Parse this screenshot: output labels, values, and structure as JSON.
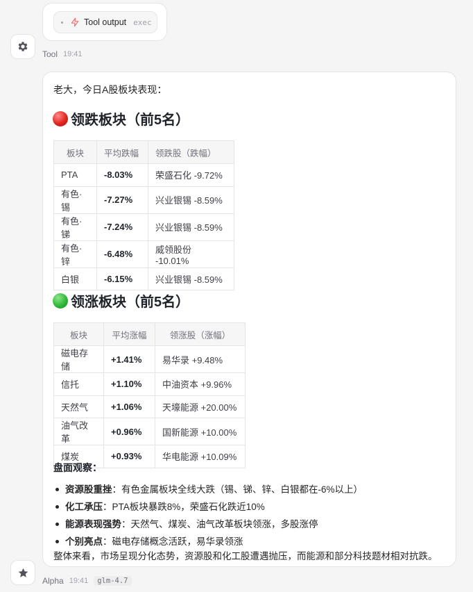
{
  "tool_card": {
    "title": "Tool output",
    "tag": "exec"
  },
  "tool_meta": {
    "author": "Tool",
    "time": "19:41"
  },
  "message": {
    "greeting": "老大，今日A股板块表现：",
    "losers": {
      "heading": "领跌板块（前5名）",
      "headers": [
        "板块",
        "平均跌幅",
        "领跌股（跌幅）"
      ],
      "rows": [
        [
          "PTA",
          "-8.03%",
          "荣盛石化 -9.72%"
        ],
        [
          "有色·锡",
          "-7.27%",
          "兴业银锡 -8.59%"
        ],
        [
          "有色·锑",
          "-7.24%",
          "兴业银锡 -8.59%"
        ],
        [
          "有色·锌",
          "-6.48%",
          "威领股份 -10.01%"
        ],
        [
          "白银",
          "-6.15%",
          "兴业银锡 -8.59%"
        ]
      ]
    },
    "gainers": {
      "heading": "领涨板块（前5名）",
      "headers": [
        "板块",
        "平均涨幅",
        "领涨股（涨幅）"
      ],
      "rows": [
        [
          "磁电存储",
          "+1.41%",
          "易华录 +9.48%"
        ],
        [
          "信托",
          "+1.10%",
          "中油资本 +9.96%"
        ],
        [
          "天然气",
          "+1.06%",
          "天壕能源 +20.00%"
        ],
        [
          "油气改革",
          "+0.96%",
          "国新能源 +10.00%"
        ],
        [
          "煤炭",
          "+0.93%",
          "华电能源 +10.09%"
        ]
      ]
    },
    "observation_title": "盘面观察：",
    "observations": [
      {
        "label": "资源股重挫",
        "text": "：有色金属板块全线大跌（锡、锑、锌、白银都在-6%以上）"
      },
      {
        "label": "化工承压",
        "text": "：PTA板块暴跌8%，荣盛石化跌近10%"
      },
      {
        "label": "能源表现强势",
        "text": "：天然气、煤炭、油气改革板块领涨，多股涨停"
      },
      {
        "label": "个别亮点",
        "text": "：磁电存储概念活跃，易华录领涨"
      }
    ],
    "summary": "整体来看，市场呈现分化态势，资源股和化工股遭遇抛压，而能源和部分科技题材相对抗跌。"
  },
  "alpha_meta": {
    "author": "Alpha",
    "time": "19:41",
    "model": "glm-4.7"
  },
  "icons": {
    "tool_avatar": "gear-icon",
    "alpha_avatar": "star-icon",
    "tool_card": "lightning-icon"
  },
  "colors": {
    "accent_red": "#e0261f",
    "accent_green": "#2fb83a",
    "lightning": "#ef6b6b"
  }
}
